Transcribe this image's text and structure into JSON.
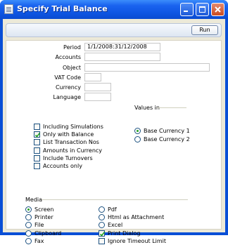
{
  "window": {
    "title": "Specify Trial Balance"
  },
  "toolbar": {
    "run_label": "Run"
  },
  "form": {
    "period": {
      "label": "Period",
      "value": "1/1/2008:31/12/2008"
    },
    "accounts": {
      "label": "Accounts",
      "value": ""
    },
    "object": {
      "label": "Object",
      "value": ""
    },
    "vat_code": {
      "label": "VAT Code",
      "value": ""
    },
    "currency": {
      "label": "Currency",
      "value": ""
    },
    "language": {
      "label": "Language",
      "value": ""
    }
  },
  "options": [
    {
      "label": "Including Simulations",
      "checked": false
    },
    {
      "label": "Only with Balance",
      "checked": true
    },
    {
      "label": "List Transaction Nos",
      "checked": false
    },
    {
      "label": "Amounts in Currency",
      "checked": false
    },
    {
      "label": "Include Turnovers",
      "checked": false
    },
    {
      "label": "Accounts only",
      "checked": false
    }
  ],
  "values_in": {
    "title": "Values in",
    "items": [
      {
        "label": "Base Currency 1",
        "selected": true
      },
      {
        "label": "Base Currency 2",
        "selected": false
      }
    ]
  },
  "media": {
    "title": "Media",
    "left": [
      {
        "label": "Screen",
        "selected": true
      },
      {
        "label": "Printer",
        "selected": false
      },
      {
        "label": "File",
        "selected": false
      },
      {
        "label": "Clipboard",
        "selected": false
      },
      {
        "label": "Fax",
        "selected": false
      }
    ],
    "right": [
      {
        "label": "Pdf",
        "kind": "radio",
        "selected": false
      },
      {
        "label": "Html as Attachment",
        "kind": "radio",
        "selected": false
      },
      {
        "label": "Excel",
        "kind": "radio",
        "selected": false
      },
      {
        "label": "Print Dialog",
        "kind": "checkbox",
        "selected": true
      },
      {
        "label": "Ignore Timeout Limit",
        "kind": "checkbox",
        "selected": false
      }
    ]
  }
}
